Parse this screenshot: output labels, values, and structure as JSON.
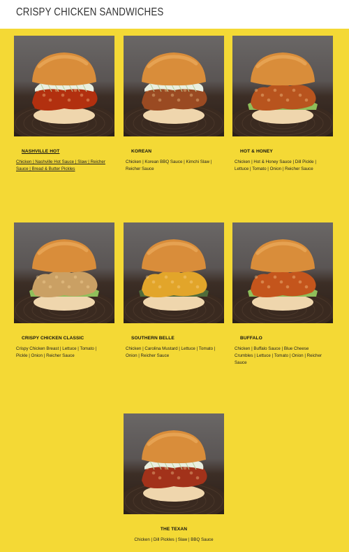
{
  "page": {
    "title": "CRISPY CHICKEN SANDWICHES"
  },
  "menu": {
    "items": [
      {
        "name": "NASHVILLE HOT",
        "description": "Chicken | Nashville Hot Sauce | Slaw | Reicher Sauce | Bread & Butter Pickles",
        "linked": true,
        "sauce_color": "#b2300f",
        "topping": "slaw"
      },
      {
        "name": "KOREAN",
        "description": "Chicken | Korean BBQ Sauce |  Kimchi Slaw | Reicher Sauce",
        "linked": false,
        "sauce_color": "#9a4a22",
        "topping": "slaw"
      },
      {
        "name": "HOT & HONEY",
        "description": "Chicken | Hot & Honey Sauce | Dill Pickle | Lettuce | Tomato | Onion | Reicher Sauce",
        "linked": false,
        "sauce_color": "#b8541e",
        "topping": "lettuce"
      },
      {
        "name": "CRISPY CHICKEN CLASSIC",
        "description": "Crispy Chicken Breast | Lettuce | Tomato | Pickle | Onion | Reicher Sauce",
        "linked": false,
        "sauce_color": "#caa064",
        "topping": "lettuce"
      },
      {
        "name": "SOUTHERN BELLE",
        "description": "Chicken | Carolina Mustard | Lettuce | Tomato | Onion | Reicher Sauce",
        "linked": false,
        "sauce_color": "#e2a52a",
        "topping": "greens"
      },
      {
        "name": "BUFFALO",
        "description": "Chicken | Buffalo Sauce | Blue Cheese Crumbles | Lettuce | Tomato | Onion | Reicher Sauce",
        "linked": false,
        "sauce_color": "#c4551c",
        "topping": "lettuce"
      },
      {
        "name": "THE TEXAN",
        "description": "Chicken | Dill Pickles | Slaw | BBQ Sauce",
        "linked": false,
        "sauce_color": "#a2321a",
        "topping": "slaw"
      }
    ]
  },
  "icons": {
    "photo": "sandwich-photo"
  }
}
